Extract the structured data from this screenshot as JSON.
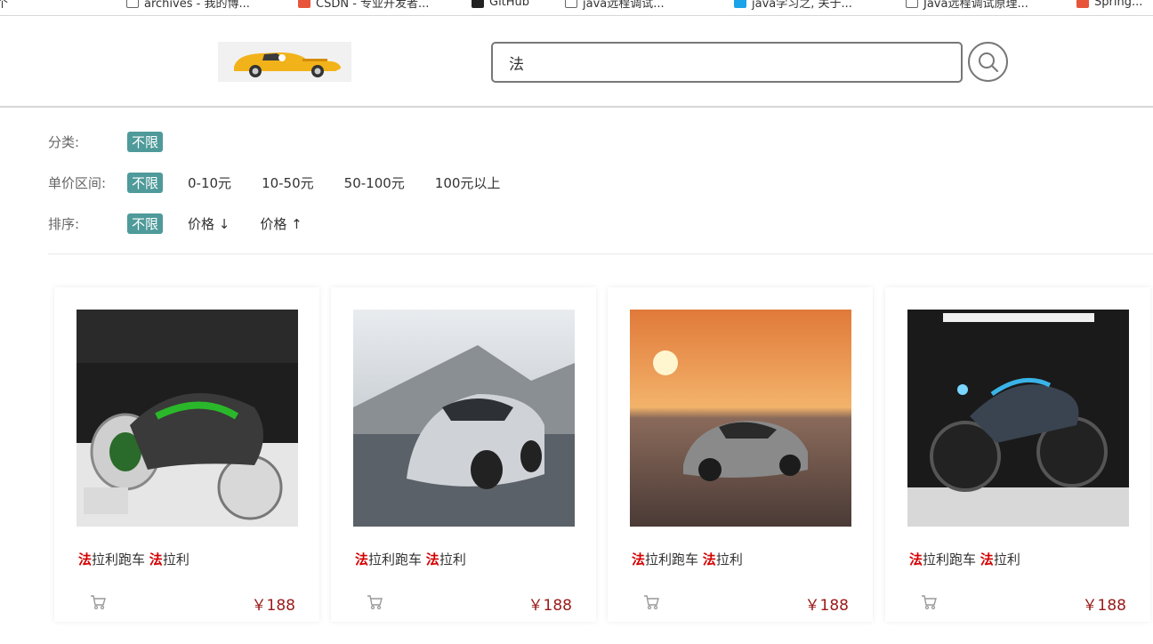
{
  "bookmarks": [
    {
      "label": "个"
    },
    {
      "label": "archives - 我的博..."
    },
    {
      "label": "CSDN - 专业开发者..."
    },
    {
      "label": "GitHub"
    },
    {
      "label": "java远程调试..."
    },
    {
      "label": "java学习之, 关于..."
    },
    {
      "label": "Java远程调试原理..."
    },
    {
      "label": "Spring..."
    }
  ],
  "header": {
    "search_value": "法",
    "search_placeholder": ""
  },
  "filters": {
    "category_label": "分类:",
    "category_options": [
      "不限"
    ],
    "price_label": "单价区间:",
    "price_options": [
      "不限",
      "0-10元",
      "10-50元",
      "50-100元",
      "100元以上"
    ],
    "sort_label": "排序:",
    "sort_options": [
      "不限",
      "价格 ↓",
      "价格 ↑"
    ]
  },
  "products": [
    {
      "highlight_1": "法",
      "mid_1": "拉利跑车 ",
      "highlight_2": "法",
      "tail": "拉利",
      "price": "￥188"
    },
    {
      "highlight_1": "法",
      "mid_1": "拉利跑车 ",
      "highlight_2": "法",
      "tail": "拉利",
      "price": "￥188"
    },
    {
      "highlight_1": "法",
      "mid_1": "拉利跑车 ",
      "highlight_2": "法",
      "tail": "拉利",
      "price": "￥188"
    },
    {
      "highlight_1": "法",
      "mid_1": "拉利跑车 ",
      "highlight_2": "法",
      "tail": "拉利",
      "price": "￥188"
    }
  ],
  "colors": {
    "accent": "#4f9a9a",
    "highlight": "#d40000",
    "price": "#9a1a1a"
  }
}
